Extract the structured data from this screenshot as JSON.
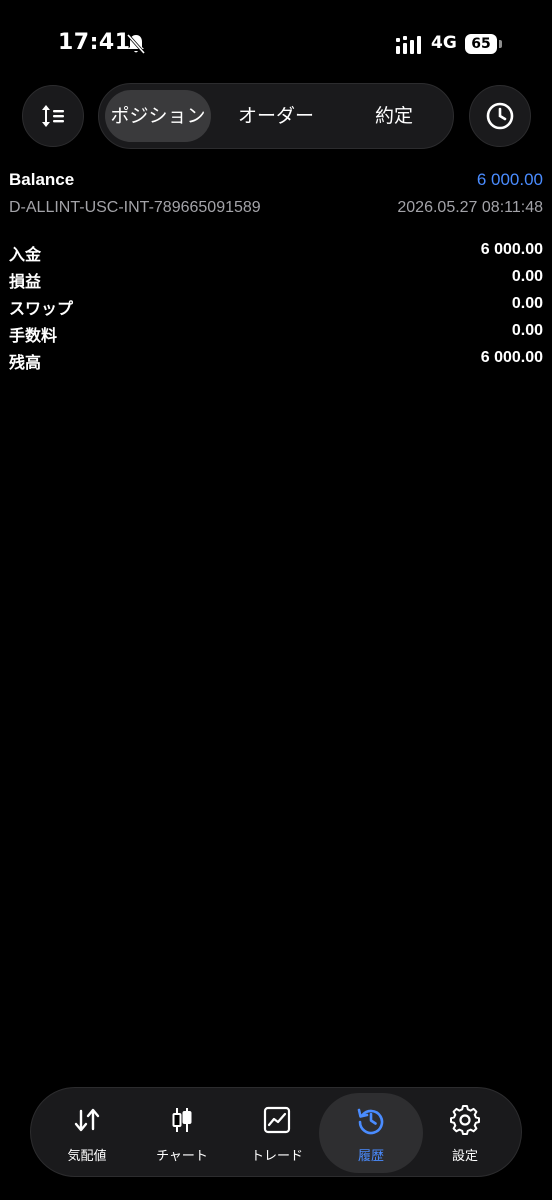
{
  "status_bar": {
    "time": "17:41",
    "network": "4G",
    "battery": "65"
  },
  "toolbar": {
    "tabs": [
      {
        "label": "ポジション",
        "active": true
      },
      {
        "label": "オーダー",
        "active": false
      },
      {
        "label": "約定",
        "active": false
      }
    ],
    "sort_icon": "sort-icon",
    "history_icon": "clock-icon"
  },
  "balance": {
    "title": "Balance",
    "amount": "6 000.00",
    "account_id": "D-ALLINT-USC-INT-789665091589",
    "datetime": "2026.05.27 08:11:48",
    "amount_color": "#4a8cff"
  },
  "details": [
    {
      "label": "入金",
      "value": "6 000.00"
    },
    {
      "label": "損益",
      "value": "0.00"
    },
    {
      "label": "スワップ",
      "value": "0.00"
    },
    {
      "label": "手数料",
      "value": "0.00"
    },
    {
      "label": "残高",
      "value": "6 000.00"
    }
  ],
  "bottom_nav": {
    "items": [
      {
        "label": "気配値",
        "icon": "quotes-icon",
        "active": false
      },
      {
        "label": "チャート",
        "icon": "candlestick-chart-icon",
        "active": false
      },
      {
        "label": "トレード",
        "icon": "trade-chart-icon",
        "active": false
      },
      {
        "label": "履歴",
        "icon": "history-icon",
        "active": true
      },
      {
        "label": "設定",
        "icon": "gear-icon",
        "active": false
      }
    ],
    "active_color": "#4a8cff"
  }
}
